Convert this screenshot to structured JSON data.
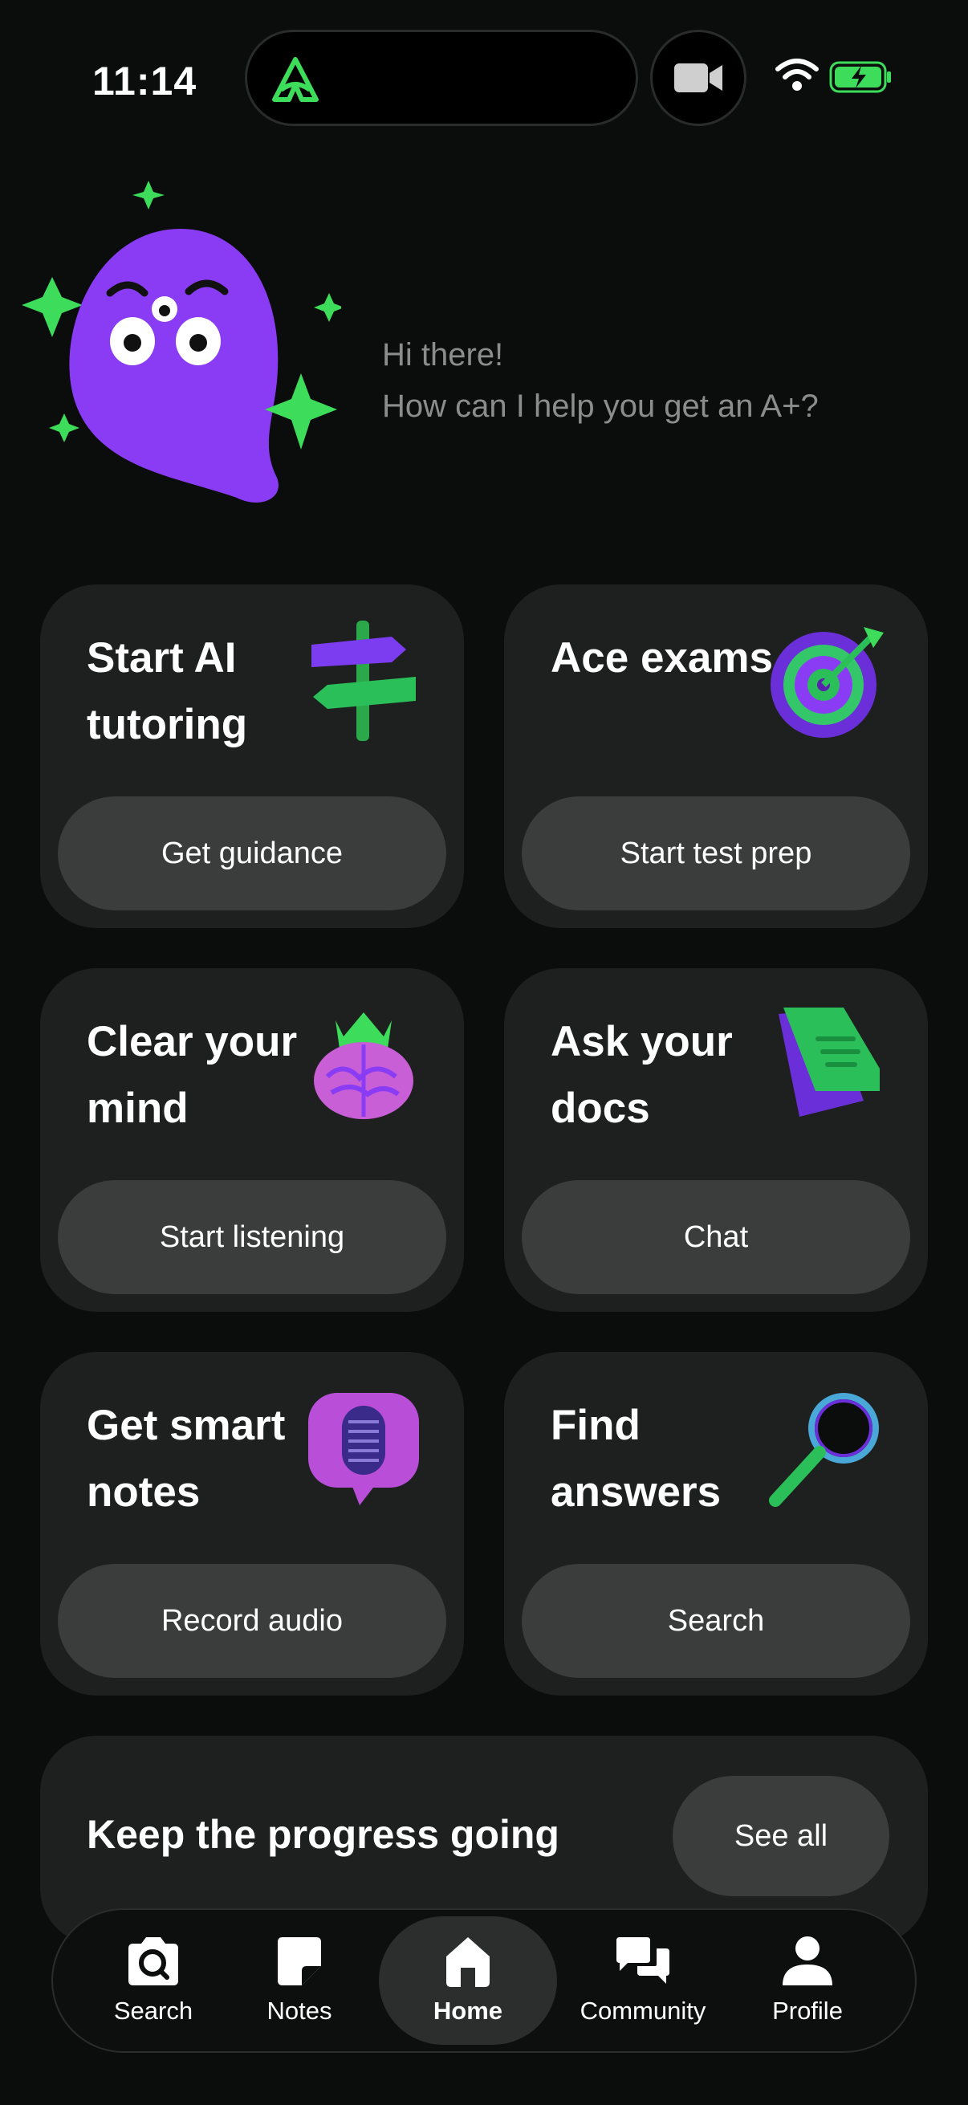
{
  "status_bar": {
    "time": "11:14",
    "icons": [
      "app-logo-icon",
      "video-camera-icon",
      "wifi-icon",
      "battery-charging-icon"
    ]
  },
  "hero": {
    "line1": "Hi there!",
    "line2": "How can I help you get an A+?"
  },
  "cards": [
    {
      "title": "Start AI tutoring",
      "button": "Get guidance",
      "icon": "signpost-icon"
    },
    {
      "title": "Ace exams",
      "button": "Start test prep",
      "icon": "target-icon"
    },
    {
      "title": "Clear your mind",
      "button": "Start listening",
      "icon": "brain-crown-icon"
    },
    {
      "title": "Ask your docs",
      "button": "Chat",
      "icon": "document-icon"
    },
    {
      "title": "Get smart notes",
      "button": "Record audio",
      "icon": "microphone-bubble-icon"
    },
    {
      "title": "Find answers",
      "button": "Search",
      "icon": "magnifier-icon"
    }
  ],
  "progress": {
    "title": "Keep the progress going",
    "see_all": "See all"
  },
  "nav": {
    "search": "Search",
    "notes": "Notes",
    "home": "Home",
    "community": "Community",
    "profile": "Profile"
  },
  "colors": {
    "background": "#0a0d0c",
    "card": "#1e1f1f",
    "button": "#3b3c3c",
    "accent_green": "#3ddc5a",
    "mascot_purple": "#8a3cf5"
  }
}
